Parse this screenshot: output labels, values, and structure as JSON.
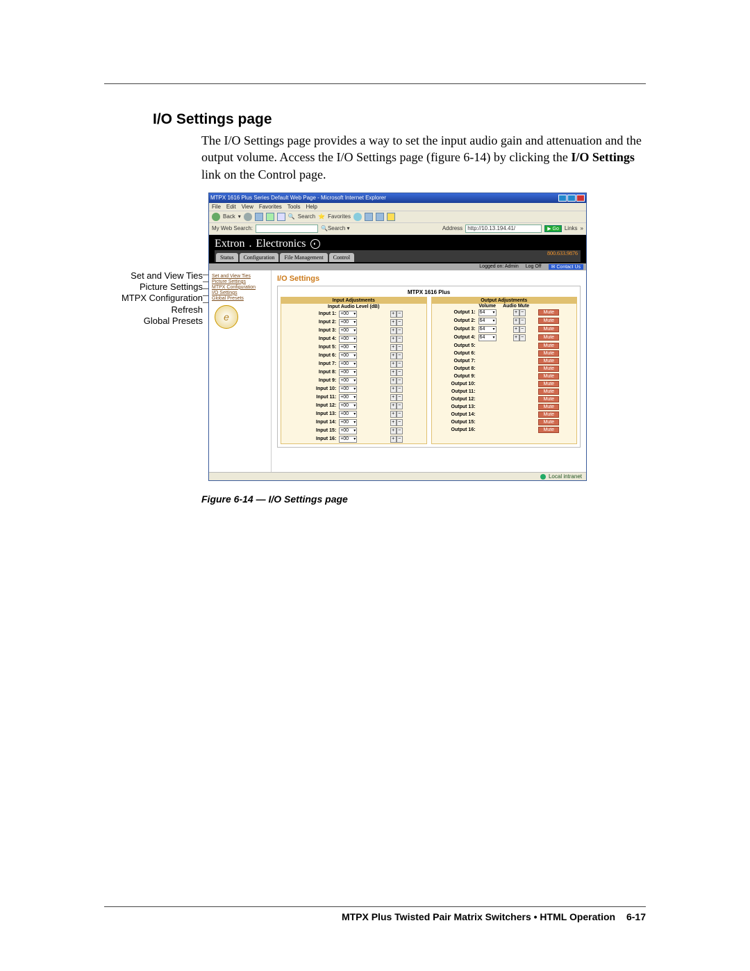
{
  "section_heading": "I/O Settings page",
  "intro_lines": [
    "The I/O Settings page provides a way to set the input audio gain and attenuation and the output volume.  Access the I/O Settings page (figure 6-14) by clicking the ",
    " link on the Control page."
  ],
  "intro_bold": "I/O Settings",
  "callouts": [
    "Set and View Ties",
    "Picture Settings",
    "MTPX Configuration",
    "Refresh",
    "Global Presets"
  ],
  "browser": {
    "title": "MTPX 1616 Plus Series Default Web Page - Microsoft Internet Explorer",
    "menus": [
      "File",
      "Edit",
      "View",
      "Favorites",
      "Tools",
      "Help"
    ],
    "back": "Back",
    "search": "Search",
    "favorites": "Favorites",
    "myweb_label": "My Web Search:",
    "addr_label": "Address",
    "addr_value": "http://10.13.194.41/",
    "go": "Go",
    "links": "Links"
  },
  "extron": {
    "brand1": "Extron",
    "brand2": "Electronics",
    "tabs": [
      "Status",
      "Configuration",
      "File Management",
      "Control"
    ],
    "phone": "800.633.9876",
    "logged": "Logged on: Admin",
    "logoff": "Log Off",
    "contact": "Contact Us"
  },
  "sidebar_links": [
    "Set and View Ties",
    "Picture Settings",
    "MTPX Configuration",
    "I/O Settings",
    "Global Presets"
  ],
  "main": {
    "heading": "I/O Settings",
    "device": "MTPX 1616 Plus",
    "input_head": "Input Adjustments",
    "input_sub": "Input Audio Level (dB)",
    "output_head": "Output Adjustments",
    "out_col1": "Volume",
    "out_col2": "Audio Mute",
    "input_level": "+00",
    "output_level": "64",
    "mute": "Mute",
    "inputs": [
      "Input 1:",
      "Input 2:",
      "Input 3:",
      "Input 4:",
      "Input 5:",
      "Input 6:",
      "Input 7:",
      "Input 8:",
      "Input 9:",
      "Input 10:",
      "Input 11:",
      "Input 12:",
      "Input 13:",
      "Input 14:",
      "Input 15:",
      "Input 16:"
    ],
    "outputs": [
      "Output 1:",
      "Output 2:",
      "Output 3:",
      "Output 4:",
      "Output 5:",
      "Output 6:",
      "Output 7:",
      "Output 8:",
      "Output 9:",
      "Output 10:",
      "Output 11:",
      "Output 12:",
      "Output 13:",
      "Output 14:",
      "Output 15:",
      "Output 16:"
    ]
  },
  "statusbar": "Local intranet",
  "caption": "Figure 6-14 — I/O Settings page",
  "footer_text": "MTPX Plus Twisted Pair Matrix Switchers • HTML Operation",
  "footer_page": "6-17"
}
